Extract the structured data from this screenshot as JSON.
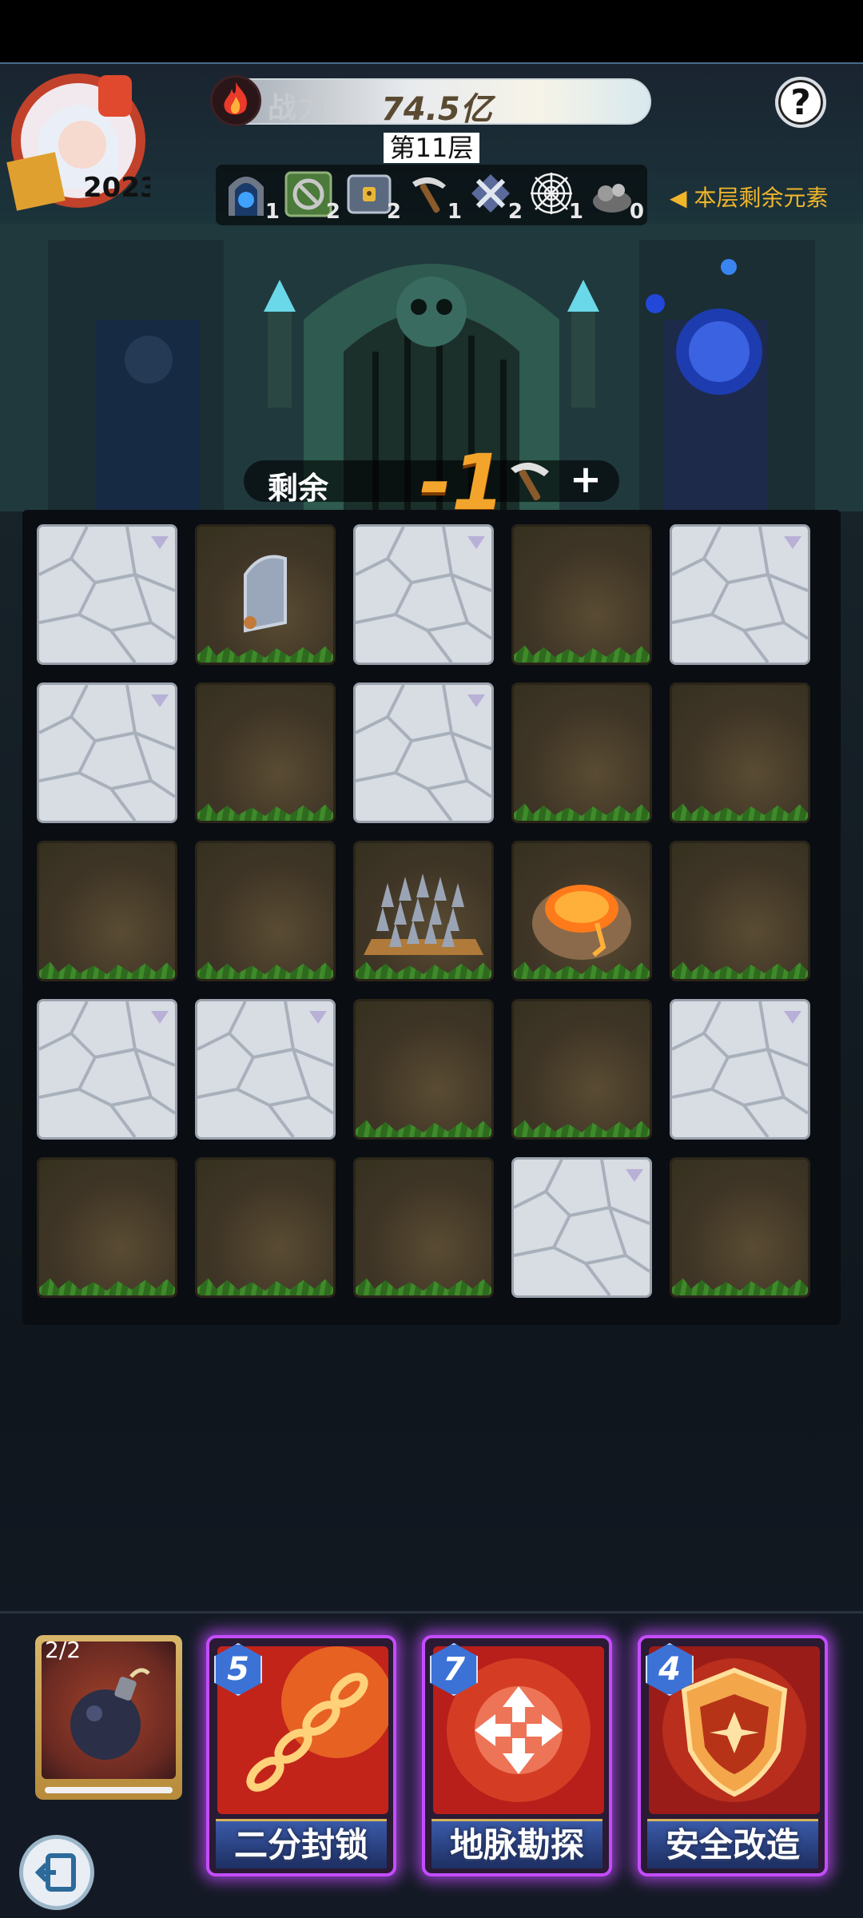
{
  "header": {
    "power_label": "战力",
    "power_value": "74.5亿",
    "floor": "第11层",
    "help_label": "?"
  },
  "elements": {
    "items": [
      {
        "icon": "portal-icon",
        "count": "1"
      },
      {
        "icon": "no-entry-icon",
        "count": "2"
      },
      {
        "icon": "locked-chest-icon",
        "count": "2"
      },
      {
        "icon": "pickaxe-icon",
        "count": "1"
      },
      {
        "icon": "crossed-swords-icon",
        "count": "2"
      },
      {
        "icon": "spider-web-icon",
        "count": "1"
      },
      {
        "icon": "rubble-icon",
        "count": "0"
      }
    ],
    "label": "本层剩余元素"
  },
  "remaining": {
    "label": "剩余",
    "value": "-1",
    "plus": "+"
  },
  "grid": [
    [
      "stone",
      "tomb",
      "stone",
      "dirt",
      "stone"
    ],
    [
      "stone",
      "dirt",
      "stone",
      "dirt",
      "dirt"
    ],
    [
      "dirt",
      "dirt",
      "spikes",
      "lava",
      "dirt"
    ],
    [
      "stone",
      "stone",
      "dirt",
      "dirt",
      "stone"
    ],
    [
      "dirt",
      "dirt",
      "dirt",
      "stone",
      "dirt"
    ]
  ],
  "bomb": {
    "count": "2/2"
  },
  "skills": [
    {
      "name": "二分封锁",
      "cost": "5"
    },
    {
      "name": "地脉勘探",
      "cost": "7"
    },
    {
      "name": "安全改造",
      "cost": "4"
    }
  ],
  "colors": {
    "accent_gold": "#f3a52b",
    "card_glow": "#c44cff",
    "cost_blue": "#3c72d6"
  }
}
